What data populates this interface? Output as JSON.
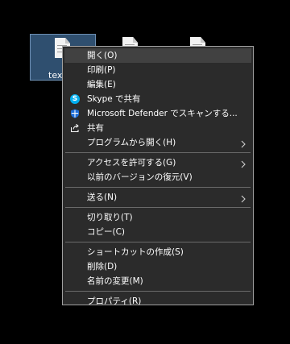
{
  "desktop": {
    "files": [
      {
        "label": "text"
      },
      {
        "label": ""
      },
      {
        "label": ""
      }
    ]
  },
  "context_menu": {
    "items": [
      {
        "label": "開く(O)"
      },
      {
        "label": "印刷(P)"
      },
      {
        "label": "編集(E)"
      },
      {
        "label": "Skype で共有",
        "icon": "skype-icon"
      },
      {
        "label": "Microsoft Defender でスキャンする...",
        "icon": "defender-shield-icon"
      },
      {
        "label": "共有",
        "icon": "share-icon"
      },
      {
        "label": "プログラムから開く(H)",
        "submenu": true
      },
      {
        "label": "アクセスを許可する(G)",
        "submenu": true
      },
      {
        "label": "以前のバージョンの復元(V)"
      },
      {
        "label": "送る(N)",
        "submenu": true
      },
      {
        "label": "切り取り(T)"
      },
      {
        "label": "コピー(C)"
      },
      {
        "label": "ショートカットの作成(S)"
      },
      {
        "label": "削除(D)"
      },
      {
        "label": "名前の変更(M)"
      },
      {
        "label": "プロパティ(R)"
      }
    ],
    "skype_glyph": "S"
  },
  "colors": {
    "menu_background": "#2b2b2b",
    "menu_highlight": "#414141",
    "selection": "#2f4f6f",
    "skype_blue": "#00aff0",
    "defender_blue": "#1f6fd8"
  }
}
